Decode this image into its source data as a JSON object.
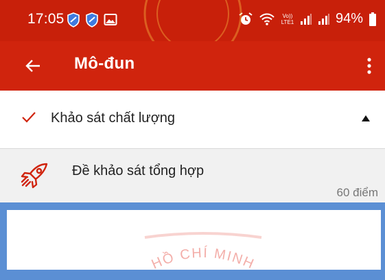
{
  "status_bar": {
    "time": "17:05",
    "battery": "94%",
    "network_label": "Vo)) LTE1",
    "icons": [
      "shield-app-icon",
      "shield-app-icon",
      "image-icon",
      "alarm-icon",
      "wifi-icon",
      "signal-icon",
      "signal-icon",
      "battery-icon"
    ]
  },
  "app_bar": {
    "title": "Mô-đun",
    "back_icon": "arrow-left-icon",
    "menu_icon": "more-vertical-icon"
  },
  "section": {
    "title": "Khảo sát chất lượng",
    "status_icon": "check-icon",
    "expanded": true
  },
  "module": {
    "title": "Đề khảo sát tổng hợp",
    "points": "60 điểm",
    "icon": "rocket-icon"
  },
  "watermark": {
    "text": "HỒ CHÍ MINH"
  },
  "colors": {
    "status_bar": "#c8200a",
    "app_bar": "#d0240d",
    "frame_blue": "#5b8fd4",
    "check": "#d0240d"
  }
}
